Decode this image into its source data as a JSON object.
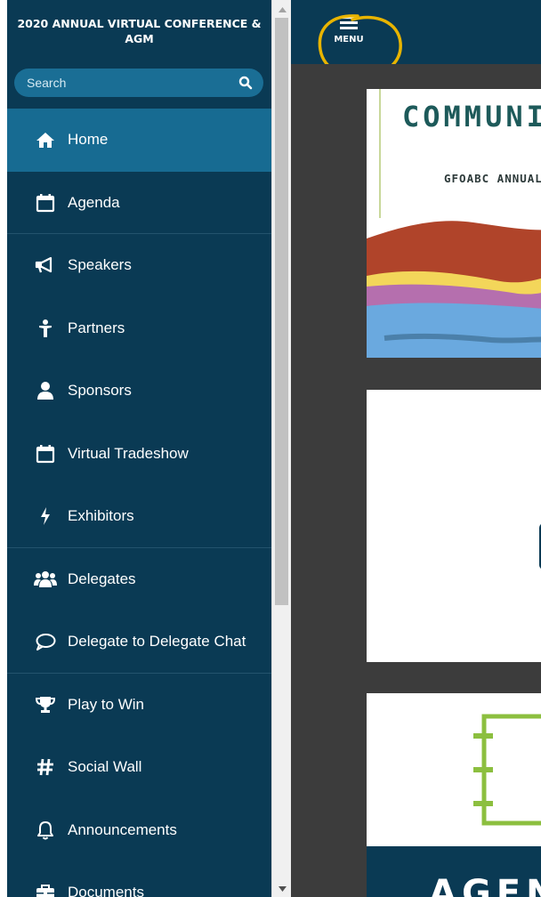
{
  "sidebar": {
    "title": "2020 ANNUAL VIRTUAL CONFERENCE & AGM",
    "search": {
      "placeholder": "Search",
      "value": ""
    },
    "items": [
      {
        "label": "Home",
        "icon": "home-icon",
        "active": true
      },
      {
        "label": "Agenda",
        "icon": "calendar-icon"
      },
      {
        "label": "Speakers",
        "icon": "megaphone-icon"
      },
      {
        "label": "Partners",
        "icon": "partner-icon"
      },
      {
        "label": "Sponsors",
        "icon": "user-icon"
      },
      {
        "label": "Virtual Tradeshow",
        "icon": "calendar-icon"
      },
      {
        "label": "Exhibitors",
        "icon": "bolt-icon"
      },
      {
        "label": "Delegates",
        "icon": "group-icon"
      },
      {
        "label": "Delegate to Delegate Chat",
        "icon": "chat-bubble-icon"
      },
      {
        "label": "Play to Win",
        "icon": "trophy-icon"
      },
      {
        "label": "Social Wall",
        "icon": "hashtag-icon"
      },
      {
        "label": "Announcements",
        "icon": "bell-icon"
      },
      {
        "label": "Documents",
        "icon": "briefcase-icon"
      }
    ]
  },
  "topbar": {
    "menu_label": "MENU"
  },
  "main": {
    "banner_title": "COMMUNIT",
    "banner_subtitle": "GFOABC ANNUAL",
    "bottom_card_text": "AGEN"
  },
  "colors": {
    "sidebar_bg": "#0a3a54",
    "active_item": "#176b92",
    "search_bg": "#1a6e95",
    "content_bg": "#3c3c3c",
    "annotation": "#e8b400"
  }
}
